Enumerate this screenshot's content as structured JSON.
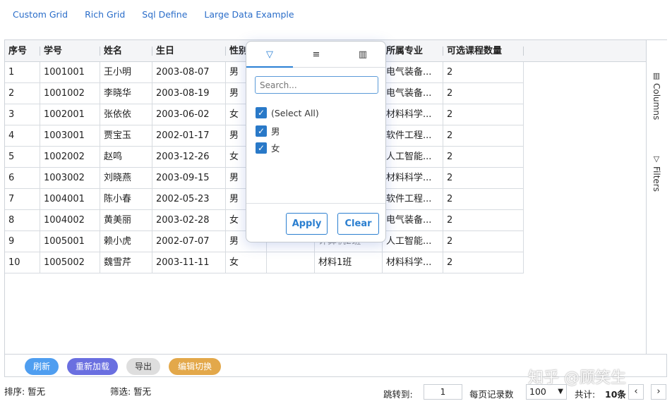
{
  "nav": [
    "Custom Grid",
    "Rich Grid",
    "Sql Define",
    "Large Data Example"
  ],
  "columns": [
    "序号",
    "学号",
    "姓名",
    "生日",
    "性别",
    "",
    "",
    "所属专业",
    "可选课程数量"
  ],
  "rows": [
    [
      "1",
      "1001001",
      "王小明",
      "2003-08-07",
      "男",
      "",
      "",
      "电气装备...",
      "2"
    ],
    [
      "2",
      "1001002",
      "李晓华",
      "2003-08-19",
      "男",
      "",
      "",
      "电气装备...",
      "2"
    ],
    [
      "3",
      "1002001",
      "张依依",
      "2003-06-02",
      "女",
      "",
      "",
      "材料科学...",
      "2"
    ],
    [
      "4",
      "1003001",
      "贾宝玉",
      "2002-01-17",
      "男",
      "",
      "",
      "软件工程...",
      "2"
    ],
    [
      "5",
      "1002002",
      "赵鸣",
      "2003-12-26",
      "女",
      "",
      "",
      "人工智能...",
      "2"
    ],
    [
      "6",
      "1003002",
      "刘晓燕",
      "2003-09-15",
      "男",
      "",
      "",
      "材料科学...",
      "2"
    ],
    [
      "7",
      "1004001",
      "陈小春",
      "2002-05-23",
      "男",
      "",
      "",
      "软件工程...",
      "2"
    ],
    [
      "8",
      "1004002",
      "黄美丽",
      "2003-02-28",
      "女",
      "",
      "",
      "电气装备...",
      "2"
    ],
    [
      "9",
      "1005001",
      "赖小虎",
      "2002-07-07",
      "男",
      "",
      "计算机2班",
      "人工智能...",
      "2"
    ],
    [
      "10",
      "1005002",
      "魏雪芹",
      "2003-11-11",
      "女",
      "",
      "材料1班",
      "材料科学...",
      "2"
    ]
  ],
  "sidebar": {
    "columns": "Columns",
    "filters": "Filters"
  },
  "toolbar": {
    "refresh": "刷新",
    "reload": "重新加载",
    "export": "导出",
    "edit_toggle": "编辑切换"
  },
  "status": {
    "sort": "排序: 暂无",
    "filter": "筛选: 暂无",
    "jump_label": "跳转到:",
    "jump_value": "1",
    "page_size_label": "每页记录数",
    "page_size": "100",
    "total_label": "共计:",
    "total_value": "10条"
  },
  "filter_popup": {
    "search_placeholder": "Search...",
    "options": [
      "(Select All)",
      "男",
      "女"
    ],
    "apply": "Apply",
    "clear": "Clear"
  },
  "watermark": "知乎 @顾笑生",
  "colors": {
    "accent": "#2a7fd4",
    "refresh": "#4f9ef0",
    "reload": "#6a6fe0",
    "edit": "#e3a84a"
  }
}
